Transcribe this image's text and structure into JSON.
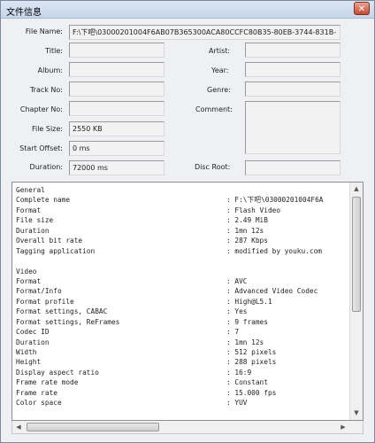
{
  "window": {
    "title": "文件信息",
    "close_glyph": "✕"
  },
  "fields": {
    "file_name": {
      "label": "File Name:",
      "value": "F:\\下吧\\03000201004F6AB07B365300ACA80CCFC80B35-80EB-3744-831B-"
    },
    "title": {
      "label": "Title:",
      "value": ""
    },
    "album": {
      "label": "Album:",
      "value": ""
    },
    "track_no": {
      "label": "Track No:",
      "value": ""
    },
    "chapter_no": {
      "label": "Chapter No:",
      "value": ""
    },
    "file_size": {
      "label": "File Size:",
      "value": "2550 KB"
    },
    "start_offset": {
      "label": "Start Offset:",
      "value": "0 ms"
    },
    "duration": {
      "label": "Duration:",
      "value": "72000 ms"
    },
    "artist": {
      "label": "Artist:",
      "value": ""
    },
    "year": {
      "label": "Year:",
      "value": ""
    },
    "genre": {
      "label": "Genre:",
      "value": ""
    },
    "comment": {
      "label": "Comment:",
      "value": ""
    },
    "disc_root": {
      "label": "Disc Root:",
      "value": ""
    }
  },
  "info_lines": [
    {
      "k": "General",
      "v": ""
    },
    {
      "k": "Complete name",
      "v": ": F:\\下吧\\03000201004F6A"
    },
    {
      "k": "Format",
      "v": ": Flash Video"
    },
    {
      "k": "File size",
      "v": ": 2.49 MiB"
    },
    {
      "k": "Duration",
      "v": ": 1mn 12s"
    },
    {
      "k": "Overall bit rate",
      "v": ": 287 Kbps"
    },
    {
      "k": "Tagging application",
      "v": ": modified by youku.com"
    },
    {
      "k": "",
      "v": ""
    },
    {
      "k": "Video",
      "v": ""
    },
    {
      "k": "Format",
      "v": ": AVC"
    },
    {
      "k": "Format/Info",
      "v": ": Advanced Video Codec"
    },
    {
      "k": "Format profile",
      "v": ": High@L5.1"
    },
    {
      "k": "Format settings, CABAC",
      "v": ": Yes"
    },
    {
      "k": "Format settings, ReFrames",
      "v": ": 9 frames"
    },
    {
      "k": "Codec ID",
      "v": ": 7"
    },
    {
      "k": "Duration",
      "v": ": 1mn 12s"
    },
    {
      "k": "Width",
      "v": ": 512 pixels"
    },
    {
      "k": "Height",
      "v": ": 288 pixels"
    },
    {
      "k": "Display aspect ratio",
      "v": ": 16:9"
    },
    {
      "k": "Frame rate mode",
      "v": ": Constant"
    },
    {
      "k": "Frame rate",
      "v": ": 15.000 fps"
    },
    {
      "k": "Color space",
      "v": ": YUV"
    }
  ],
  "scrollbars": {
    "up": "▲",
    "down": "▼",
    "left": "◀",
    "right": "▶"
  }
}
